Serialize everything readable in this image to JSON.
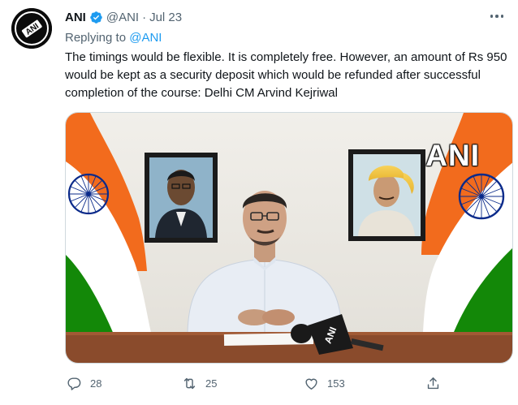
{
  "tweet": {
    "author_name": "ANI",
    "handle": "@ANI",
    "separator": "·",
    "date": "Jul 23",
    "replying_prefix": "Replying to",
    "replying_to": "@ANI",
    "text": "The timings would be flexible. It is completely free. However, an amount of Rs 950 would be kept as a security deposit which would be refunded after successful completion of the course: Delhi CM Arvind Kejriwal",
    "media": {
      "watermark": "ANI",
      "mic_label": "ANI"
    },
    "actions": {
      "replies": "28",
      "retweets": "25",
      "likes": "153"
    }
  },
  "colors": {
    "verified_badge": "#1d9bf0",
    "link": "#1d9bf0",
    "secondary_text": "#536471",
    "saffron": "#f26b1d",
    "green": "#138808",
    "chakra": "#0a2a8a"
  },
  "icons": {
    "verified": "verified-badge-icon",
    "more": "more-options-icon",
    "reply": "reply-icon",
    "retweet": "retweet-icon",
    "like": "heart-icon",
    "share": "share-icon",
    "avatar": "ani-logo-avatar"
  }
}
